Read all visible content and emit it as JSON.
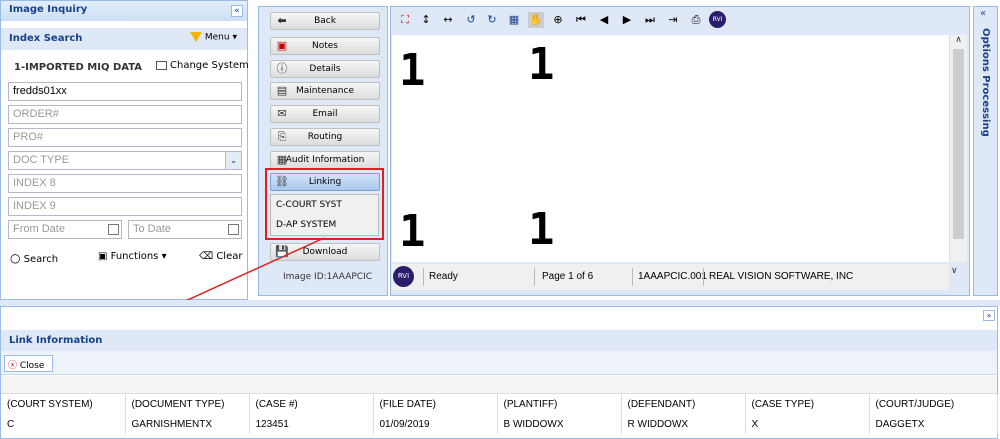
{
  "left_panel": {
    "title": "Image Inquiry",
    "collapse_glyph": "«",
    "section": "Index Search",
    "menu": "Menu",
    "system_name": "1-IMPORTED MIQ DATA",
    "change_system": "Change System",
    "fields": {
      "user": "fredds01xx",
      "order": "ORDER#",
      "pro": "PRO#",
      "doc_type": "DOC TYPE",
      "index8": "INDEX 8",
      "index9": "INDEX 9",
      "from_date": "From Date",
      "to_date": "To Date"
    },
    "search": "Search",
    "functions": "Functions",
    "clear": "Clear"
  },
  "actions": {
    "back": "Back",
    "notes": "Notes",
    "details": "Details",
    "maintenance": "Maintenance",
    "email": "Email",
    "routing": "Routing",
    "audit": "Audit Information",
    "linking": "Linking",
    "download": "Download",
    "image_id": "Image ID:1AAAPCIC",
    "linking_menu": [
      "C-COURT SYST",
      "D-AP SYSTEM"
    ]
  },
  "viewer": {
    "digits": [
      "1",
      "1",
      "1",
      "1"
    ],
    "status": "Ready",
    "page": "Page 1 of 6",
    "file": "1AAAPCIC.001",
    "company": "REAL VISION SOFTWARE, INC",
    "logo": "RVI"
  },
  "options": {
    "title": "Options Processing",
    "glyph": "«"
  },
  "link_info": {
    "title": "Link Information",
    "close": "Close",
    "columns": [
      "(COURT SYSTEM)",
      "(DOCUMENT TYPE)",
      "(CASE #)",
      "(FILE DATE)",
      "(PLANTIFF)",
      "(DEFENDANT)",
      "(CASE TYPE)",
      "(COURT/JUDGE)"
    ],
    "row": [
      "C",
      "GARNISHMENTX",
      "123451",
      "01/09/2019",
      "B WIDDOWX",
      "R WIDDOWX",
      "X",
      "DAGGETX"
    ]
  },
  "colors": {
    "header_text": "#15428b",
    "highlight": "#e02020",
    "panel_bg": "#dfe8f6"
  }
}
